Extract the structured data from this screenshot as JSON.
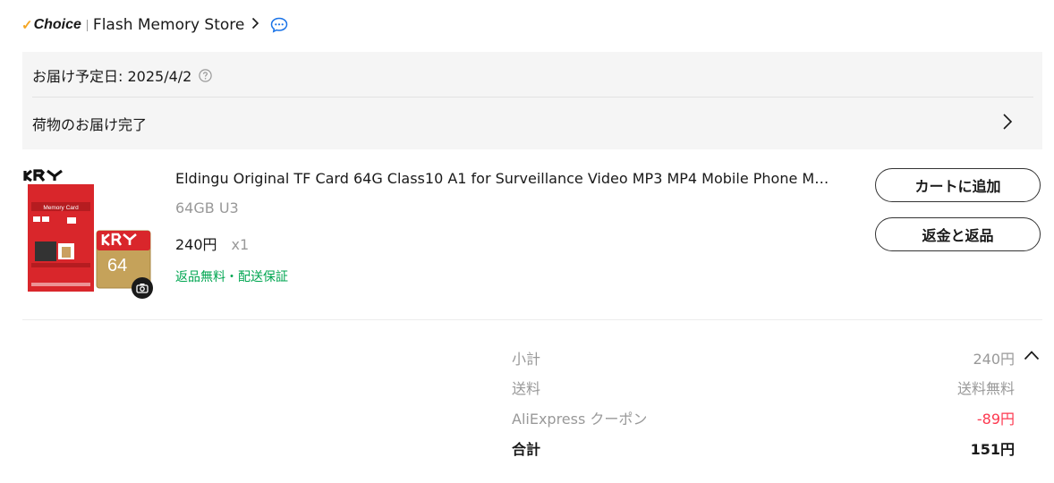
{
  "store": {
    "badge": "Choice",
    "name": "Flash Memory Store"
  },
  "delivery": {
    "expected_label": "お届け予定日: 2025/4/2",
    "status": "荷物のお届け完了"
  },
  "product": {
    "thumbnail_brand": "KRY",
    "thumbnail_card_label": "Memory Card",
    "thumbnail_capacity": "64",
    "title": "Eldingu Original TF Card 64G Class10 A1 for Surveillance Video MP3 MP4 Mobile Phone M…",
    "sku": "64GB U3",
    "price": "240円",
    "quantity": "x1",
    "service_tags": "返品無料・配送保証"
  },
  "actions": {
    "add_to_cart": "カートに追加",
    "refund_return": "返金と返品"
  },
  "summary": {
    "subtotal_label": "小計",
    "subtotal_value": "240円",
    "shipping_label": "送料",
    "shipping_value": "送料無料",
    "coupon_label": "AliExpress クーポン",
    "coupon_value": "-89円",
    "total_label": "合計",
    "total_value": "151円"
  },
  "colors": {
    "accent_green": "#00a651",
    "discount_red": "#fd384f",
    "choice_check": "#f5a623",
    "chat_blue": "#1a73e8"
  }
}
